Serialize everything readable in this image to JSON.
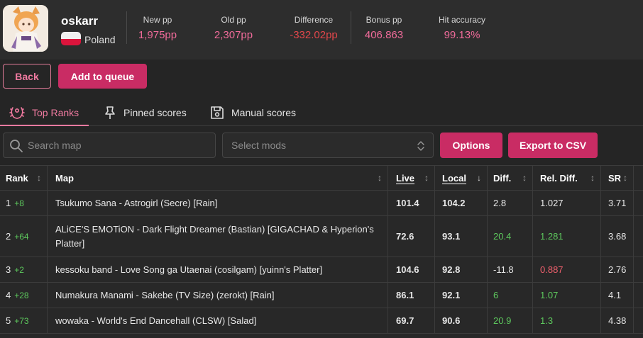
{
  "user": {
    "name": "oskarr",
    "country": "Poland"
  },
  "stats": [
    {
      "label": "New pp",
      "value": "1,975pp"
    },
    {
      "label": "Old pp",
      "value": "2,307pp"
    },
    {
      "label": "Difference",
      "value": "-332.02pp"
    },
    {
      "label": "Bonus pp",
      "value": "406.863"
    },
    {
      "label": "Hit accuracy",
      "value": "99.13%"
    }
  ],
  "actions": {
    "back": "Back",
    "add_to_queue": "Add to queue",
    "options": "Options",
    "export_csv": "Export to CSV"
  },
  "tabs": [
    {
      "label": "Top Ranks",
      "icon": "laurel-icon",
      "active": true
    },
    {
      "label": "Pinned scores",
      "icon": "pin-icon",
      "active": false
    },
    {
      "label": "Manual scores",
      "icon": "floppy-disk-icon",
      "active": false
    }
  ],
  "search": {
    "placeholder": "Search map",
    "value": ""
  },
  "mods_select": {
    "placeholder": "Select mods"
  },
  "colors": {
    "accent": "#c92c64",
    "accent_text": "#f07aa0",
    "negative": "#e2474b",
    "positive": "#5dc85d"
  },
  "table": {
    "columns": [
      "Rank",
      "Map",
      "Live",
      "Local",
      "Diff.",
      "Rel. Diff.",
      "SR"
    ],
    "sort": {
      "column": "Local",
      "direction": "descending"
    },
    "rows": [
      {
        "rank": "1",
        "gain": "+8",
        "map": "Tsukumo Sana - Astrogirl (Secre) [Rain]",
        "live": "101.4",
        "local": "104.2",
        "diff": "2.8",
        "rel": "1.027",
        "rel_trend": "none",
        "sr": "3.71"
      },
      {
        "rank": "2",
        "gain": "+64",
        "map": "ALiCE'S EMOTiON - Dark Flight Dreamer (Bastian) [GIGACHAD & Hyperion's Platter]",
        "live": "72.6",
        "local": "93.1",
        "diff": "20.4",
        "rel": "1.281",
        "rel_trend": "up",
        "sr": "3.68"
      },
      {
        "rank": "3",
        "gain": "+2",
        "map": "kessoku band - Love Song ga Utaenai (cosilgam) [yuinn's Platter]",
        "live": "104.6",
        "local": "92.8",
        "diff": "-11.8",
        "rel": "0.887",
        "rel_trend": "down",
        "sr": "2.76"
      },
      {
        "rank": "4",
        "gain": "+28",
        "map": "Numakura Manami - Sakebe (TV Size) (zerokt) [Rain]",
        "live": "86.1",
        "local": "92.1",
        "diff": "6",
        "rel": "1.07",
        "rel_trend": "up",
        "sr": "4.1"
      },
      {
        "rank": "5",
        "gain": "+73",
        "map": "wowaka - World's End Dancehall (CLSW) [Salad]",
        "live": "69.7",
        "local": "90.6",
        "diff": "20.9",
        "rel": "1.3",
        "rel_trend": "up",
        "sr": "4.38"
      }
    ]
  }
}
